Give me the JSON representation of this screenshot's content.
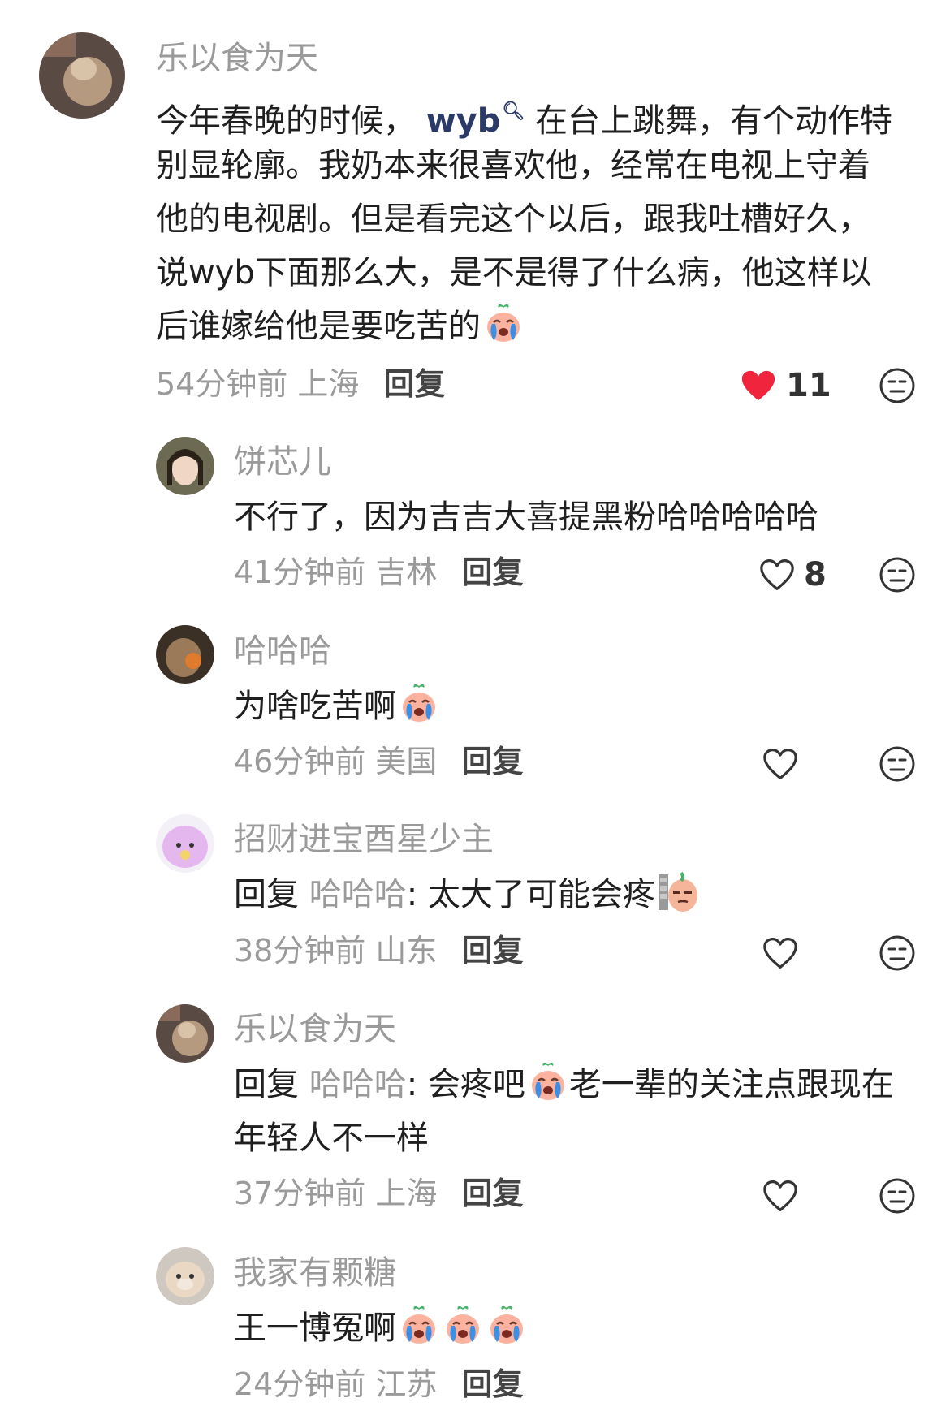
{
  "comments": [
    {
      "name": "乐以食为天",
      "text_before": "今年春晚的时候，",
      "link": "wyb",
      "text_after_line1": "在台上跳舞，有个动作特",
      "lines": [
        "别显轮廓。我奶本来很喜欢他，经常在电视上守着",
        "他的电视剧。但是看完这个以后，跟我吐槽好久，",
        "说wyb下面那么大，是不是得了什么病，他这样以",
        "后谁嫁给他是要吃苦的"
      ],
      "time": "54分钟前 上海",
      "reply": "回复",
      "likes": "11",
      "emoji": "crying-face"
    },
    {
      "name": "饼芯儿",
      "text": "不行了，因为吉吉大喜提黑粉哈哈哈哈哈",
      "time": "41分钟前 吉林",
      "reply": "回复",
      "likes": "8"
    },
    {
      "name": "哈哈哈",
      "text": "为啥吃苦啊",
      "time": "46分钟前 美国",
      "reply": "回复",
      "emoji": "crying-face"
    },
    {
      "name": "招财进宝酉星少主",
      "reply_prefix": "回复",
      "reply_to": "哈哈哈",
      "text": ": 太大了可能会疼",
      "time": "38分钟前 山东",
      "reply": "回复",
      "emoji": "peeking-face"
    },
    {
      "name": "乐以食为天",
      "reply_prefix": "回复",
      "reply_to": "哈哈哈",
      "text": ": 会疼吧",
      "text2": "老一辈的关注点跟现在",
      "line2": "年轻人不一样",
      "time": "37分钟前 上海",
      "reply": "回复",
      "emoji": "crying-face"
    },
    {
      "name": "我家有颗糖",
      "text": "王一博冤啊",
      "time": "24分钟前 江苏",
      "reply": "回复",
      "emoji": "crying-face"
    }
  ],
  "colors": {
    "name": "#9a9a9a",
    "text": "#1f1f1f",
    "like_active": "#f0243c",
    "link": "#2b3a67"
  }
}
